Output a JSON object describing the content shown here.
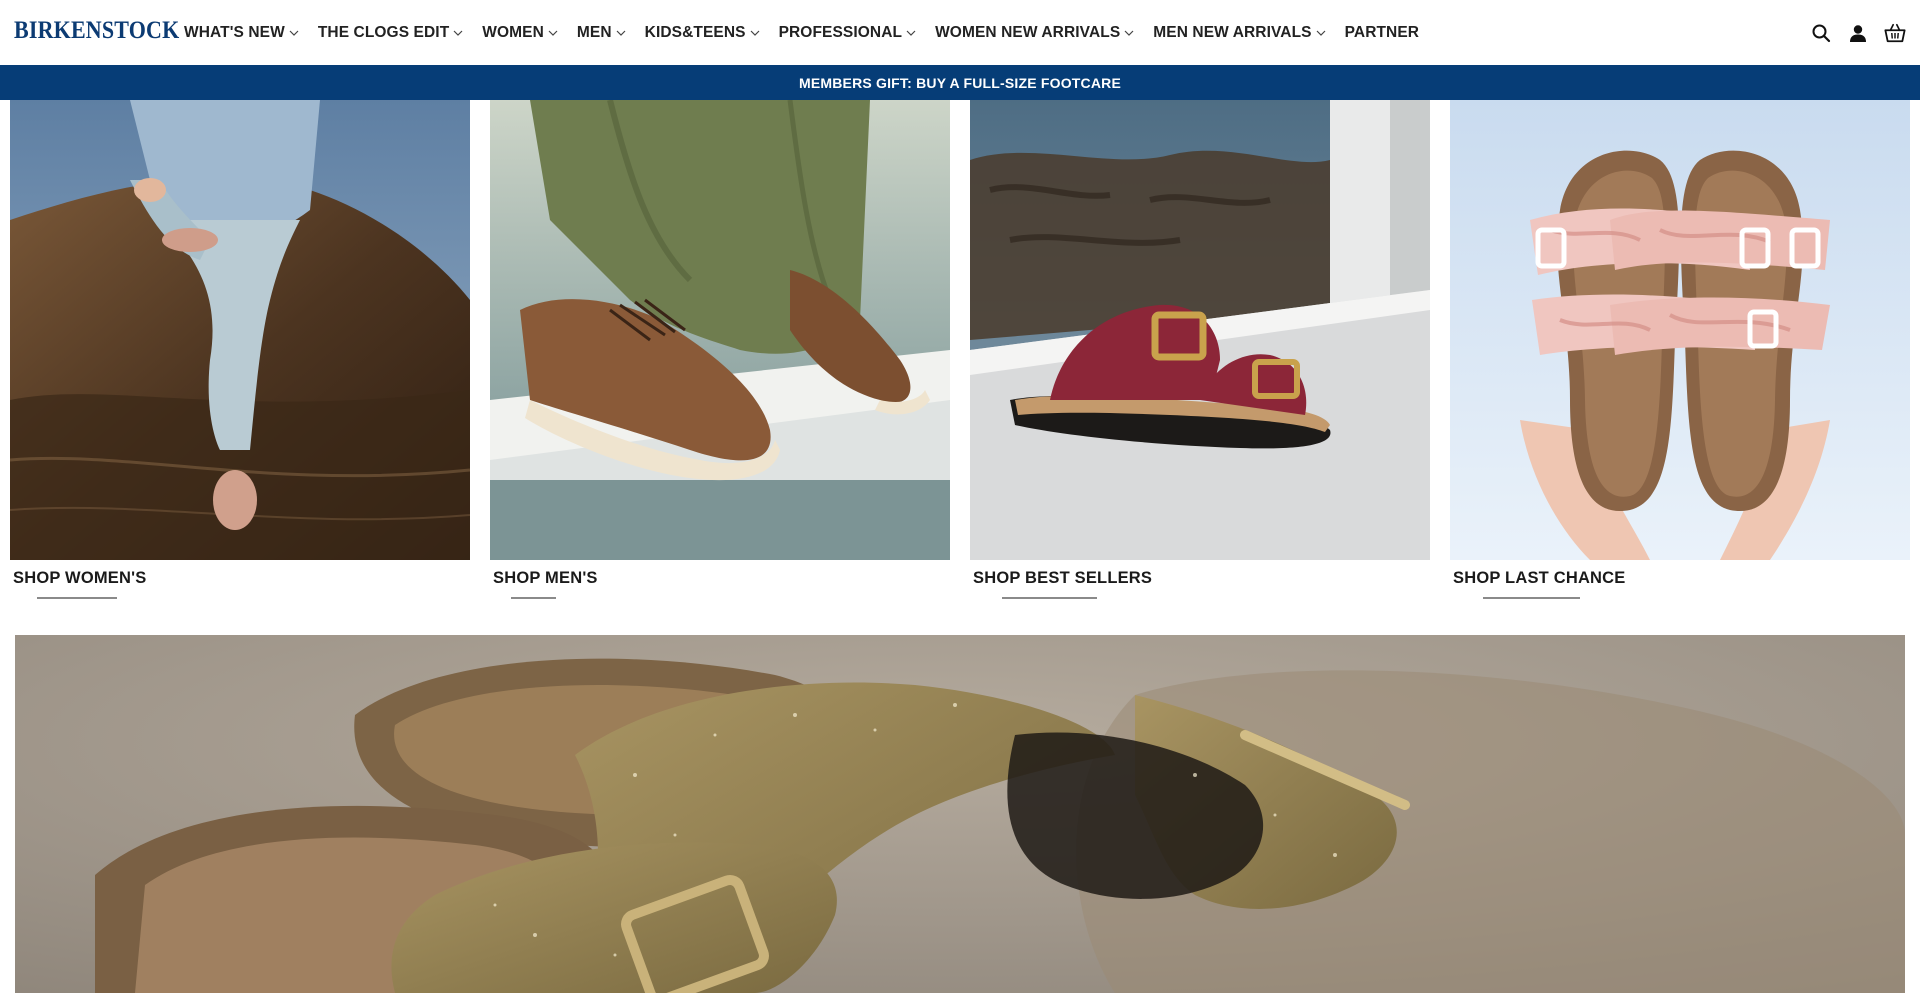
{
  "brand": {
    "logo_text": "BIRKENSTOCK",
    "color": "#0c3b73"
  },
  "nav": {
    "items": [
      {
        "label": "WHAT'S NEW",
        "dropdown": true
      },
      {
        "label": "THE CLOGS EDIT",
        "dropdown": true
      },
      {
        "label": "WOMEN",
        "dropdown": true
      },
      {
        "label": "MEN",
        "dropdown": true
      },
      {
        "label": "KIDS&TEENS",
        "dropdown": true
      },
      {
        "label": "PROFESSIONAL",
        "dropdown": true
      },
      {
        "label": "WOMEN NEW ARRIVALS",
        "dropdown": true
      },
      {
        "label": "MEN NEW ARRIVALS",
        "dropdown": true
      },
      {
        "label": "PARTNER",
        "dropdown": false
      }
    ],
    "icons": [
      "search-icon",
      "account-icon",
      "cart-icon"
    ]
  },
  "promo": {
    "text": "MEMBERS GIFT: BUY A FULL-SIZE FOOTCARE",
    "background": "#063d77"
  },
  "categories": [
    {
      "label": "SHOP WOMEN'S"
    },
    {
      "label": "SHOP MEN'S"
    },
    {
      "label": "SHOP BEST SELLERS"
    },
    {
      "label": "SHOP LAST CHANCE"
    }
  ],
  "hero": {
    "image": "glitter-suede-sandals"
  }
}
